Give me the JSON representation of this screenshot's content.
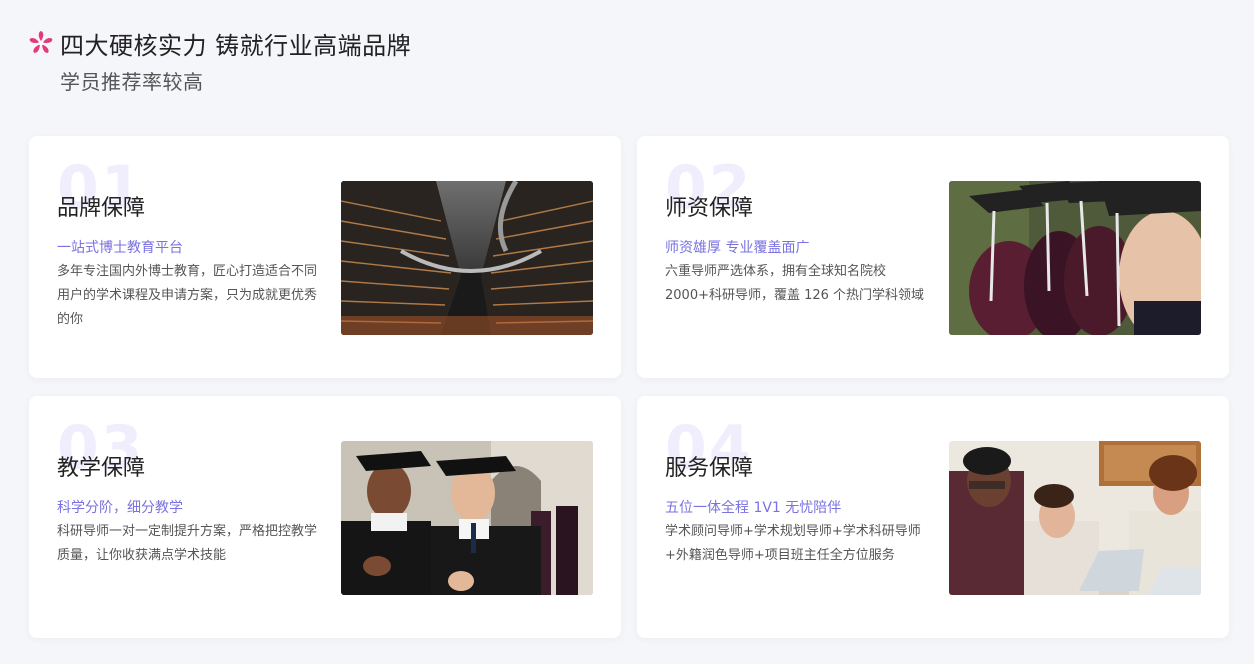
{
  "header": {
    "title": "四大硬核实力 铸就行业高端品牌",
    "subtitle": "学员推荐率较高",
    "icon": "bauhinia-flower-icon",
    "icon_color": "#e23a7a"
  },
  "accent_color": "#7a72e0",
  "cards": [
    {
      "num": "01",
      "title": "品牌保障",
      "tag": "一站式博士教育平台",
      "desc": "多年专注国内外博士教育，匠心打造适合不同用户的学术课程及申请方案，只为成就更优秀的你",
      "photo": "modern-building-photo"
    },
    {
      "num": "02",
      "title": "师资保障",
      "tag": "师资雄厚 专业覆盖面广",
      "desc": "六重导师严选体系，拥有全球知名院校2000+科研导师，覆盖 126 个热门学科领域",
      "photo": "graduation-caps-photo"
    },
    {
      "num": "03",
      "title": "教学保障",
      "tag": "科学分阶，细分教学",
      "desc": "科研导师一对一定制提升方案，严格把控教学质量，让你收获满点学术技能",
      "photo": "graduates-thumbs-up-photo"
    },
    {
      "num": "04",
      "title": "服务保障",
      "tag": "五位一体全程 1V1 无忧陪伴",
      "desc": "学术顾问导师+学术规划导师+学术科研导师+外籍润色导师+项目班主任全方位服务",
      "photo": "team-laptop-photo"
    }
  ]
}
